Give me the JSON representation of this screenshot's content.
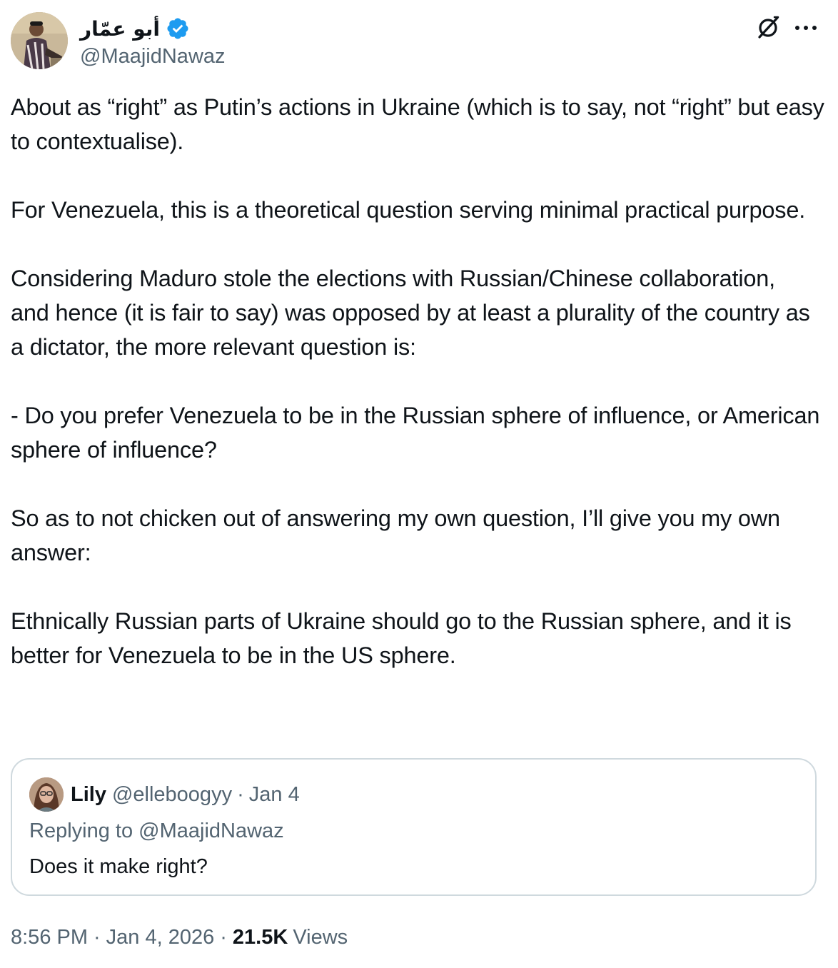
{
  "author": {
    "display_name": "أبو عمّار",
    "handle": "@MaajidNawaz",
    "verified_icon": "verified-badge-icon",
    "verified_color": "#1d9bf0"
  },
  "header_actions": {
    "grok_icon": "grok-icon",
    "more_icon": "more-dots-icon"
  },
  "tweet": {
    "text": "About as “right” as Putin’s actions in Ukraine (which is to say, not “right” but easy to contextualise).\n\nFor Venezuela, this is a theoretical question serving minimal practical purpose.\n\nConsidering Maduro stole the elections with Russian/Chinese collaboration,\nand hence (it is fair to say) was opposed by at least a plurality of the country as a dictator, the more relevant question is:\n\n- Do you prefer Venezuela to be in the Russian sphere of influence, or American sphere of influence?\n\nSo as to not chicken out of answering my own question, I’ll give you my own answer:\n\nEthnically Russian parts of Ukraine should go to the Russian sphere, and it is better for Venezuela to be in the US sphere."
  },
  "quoted": {
    "name": "Lily",
    "handle": "@elleboogyy",
    "separator": "·",
    "date": "Jan 4",
    "reply_label": "Replying to @MaajidNawaz",
    "text": "Does it make right?"
  },
  "footer": {
    "time": "8:56 PM",
    "separator": "·",
    "date": "Jan 4, 2026",
    "views_count": "21.5K",
    "views_label": "Views"
  },
  "colors": {
    "text": "#0f1419",
    "secondary": "#536471",
    "border": "#cfd9de"
  }
}
